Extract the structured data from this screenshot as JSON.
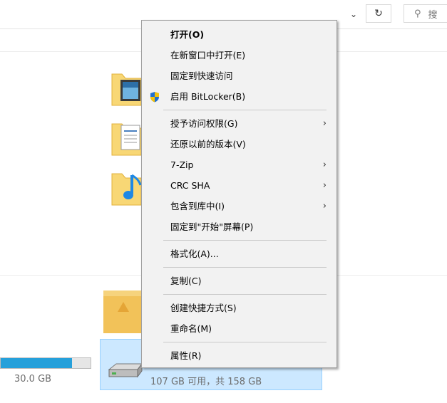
{
  "toolbar": {
    "chevron_glyph": "⌄",
    "refresh_glyph": "↻",
    "search_glyph": "⚲",
    "search_placeholder": "搜"
  },
  "drives": {
    "left_drive": {
      "text": "30.0 GB",
      "used_fraction": 0.78
    },
    "selected_drive": {
      "text": "107 GB 可用，共 158 GB",
      "used_fraction": 0.32
    }
  },
  "menu": {
    "items": [
      {
        "id": "open",
        "label": "打开(O)",
        "bold": true,
        "arrow": false
      },
      {
        "id": "open-new-window",
        "label": "在新窗口中打开(E)",
        "bold": false,
        "arrow": false
      },
      {
        "id": "pin-quick-access",
        "label": "固定到快速访问",
        "bold": false,
        "arrow": false
      },
      {
        "id": "bitlocker",
        "label": "启用 BitLocker(B)",
        "bold": false,
        "arrow": false,
        "icon": "shield-icon"
      },
      {
        "divider": true
      },
      {
        "id": "grant-access",
        "label": "授予访问权限(G)",
        "bold": false,
        "arrow": true
      },
      {
        "id": "restore-versions",
        "label": "还原以前的版本(V)",
        "bold": false,
        "arrow": false
      },
      {
        "id": "7zip",
        "label": "7-Zip",
        "bold": false,
        "arrow": true
      },
      {
        "id": "crc-sha",
        "label": "CRC SHA",
        "bold": false,
        "arrow": true
      },
      {
        "id": "include-library",
        "label": "包含到库中(I)",
        "bold": false,
        "arrow": true
      },
      {
        "id": "pin-start",
        "label": "固定到\"开始\"屏幕(P)",
        "bold": false,
        "arrow": false
      },
      {
        "divider": true
      },
      {
        "id": "format",
        "label": "格式化(A)...",
        "bold": false,
        "arrow": false
      },
      {
        "divider": true
      },
      {
        "id": "copy",
        "label": "复制(C)",
        "bold": false,
        "arrow": false
      },
      {
        "divider": true
      },
      {
        "id": "create-shortcut",
        "label": "创建快捷方式(S)",
        "bold": false,
        "arrow": false
      },
      {
        "id": "rename",
        "label": "重命名(M)",
        "bold": false,
        "arrow": false
      },
      {
        "divider": true
      },
      {
        "id": "properties",
        "label": "属性(R)",
        "bold": false,
        "arrow": false
      }
    ],
    "arrow_glyph": "›"
  },
  "colors": {
    "selection_bg": "#cce8ff",
    "bar_fill": "#26a0da",
    "folder_yellow": "#f8d775"
  }
}
